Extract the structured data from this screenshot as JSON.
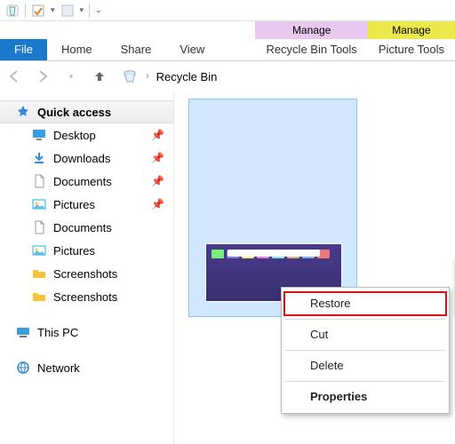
{
  "ctx_tabs": {
    "recycle": {
      "header": "Manage",
      "tab": "Recycle Bin Tools"
    },
    "picture": {
      "header": "Manage",
      "tab": "Picture Tools"
    }
  },
  "tabs": {
    "file": "File",
    "home": "Home",
    "share": "Share",
    "view": "View"
  },
  "address": {
    "location": "Recycle Bin"
  },
  "sidebar": {
    "quick": "Quick access",
    "items": [
      {
        "label": "Desktop"
      },
      {
        "label": "Downloads"
      },
      {
        "label": "Documents"
      },
      {
        "label": "Pictures"
      },
      {
        "label": "Documents"
      },
      {
        "label": "Pictures"
      },
      {
        "label": "Screenshots"
      },
      {
        "label": "Screenshots"
      }
    ],
    "thispc": "This PC",
    "network": "Network"
  },
  "context_menu": {
    "restore": "Restore",
    "cut": "Cut",
    "delete": "Delete",
    "properties": "Properties"
  }
}
